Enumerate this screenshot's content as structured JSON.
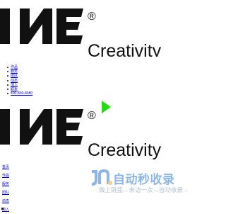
{
  "logo": {
    "wordmark": "INE",
    "registered": "®",
    "tagline": "Creativity"
  },
  "nav": {
    "items": [
      {
        "label": "作品"
      },
      {
        "label": "服务"
      },
      {
        "label": "团队"
      },
      {
        "label": "动态"
      },
      {
        "label": "加入"
      },
      {
        "label": "联系"
      },
      {
        "label": "400-800-8080"
      }
    ]
  },
  "footer": {
    "links": [
      {
        "label": "首页"
      },
      {
        "label": "作品"
      },
      {
        "label": "服务"
      },
      {
        "label": "团队"
      },
      {
        "label": "动态"
      },
      {
        "label": "加入"
      }
    ]
  },
  "watermark": {
    "title": "自动秒收录",
    "subtitle": "做上链接→来访一次→自动收录→"
  },
  "colors": {
    "logo": "#111111",
    "link": "#0000ee",
    "accent_green": "#22dd11",
    "watermark_blue": "#2e7bd6",
    "watermark_orange": "#f5a623"
  }
}
